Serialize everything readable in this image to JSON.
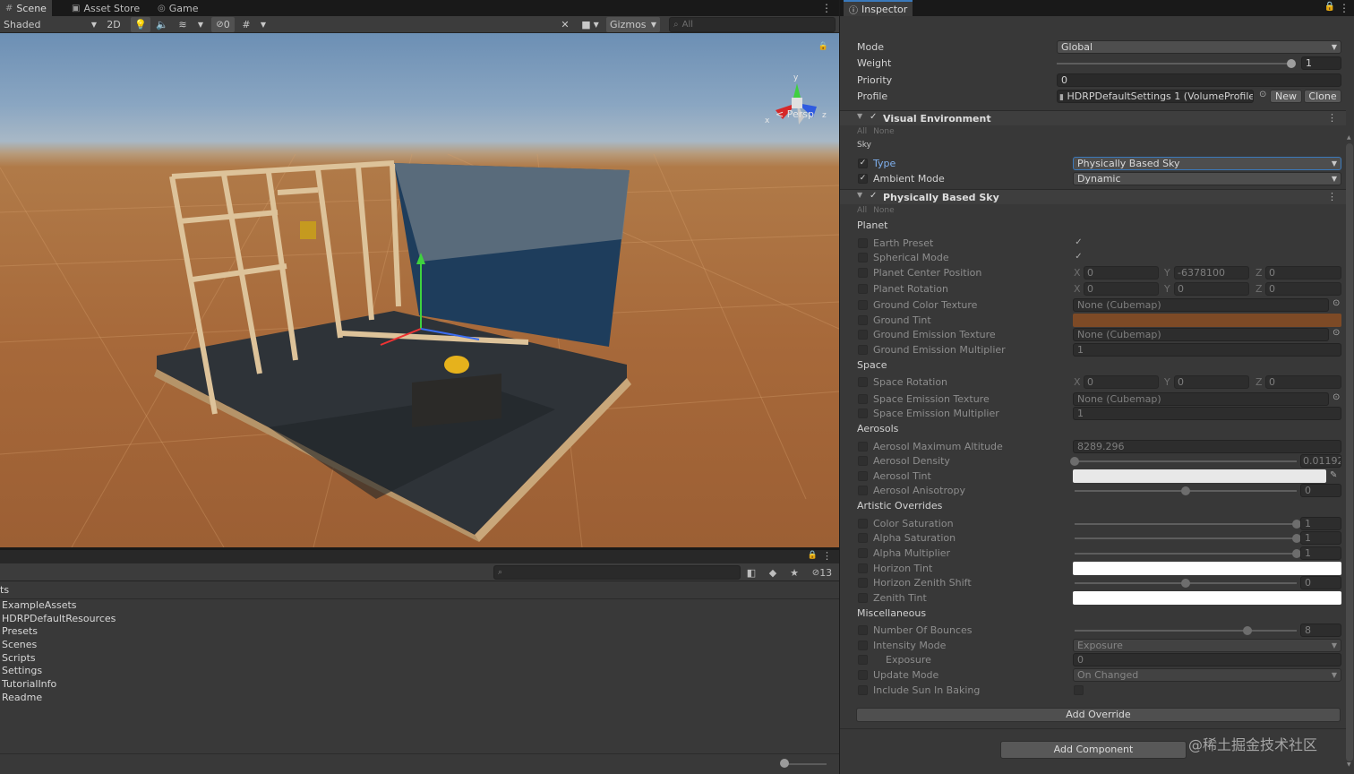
{
  "scene": {
    "tabs": [
      {
        "label": "Scene",
        "icon": "grid-icon"
      },
      {
        "label": "Asset Store",
        "icon": "store-icon"
      },
      {
        "label": "Game",
        "icon": "gamepad-icon"
      }
    ],
    "toolbar": {
      "draw_mode": "Shaded",
      "mode_2d": "2D",
      "hidden_count": "0",
      "gizmos": "Gizmos",
      "search_placeholder": "All"
    },
    "view_label": "Persp",
    "axis_labels": {
      "x": "x",
      "y": "y",
      "z": "z"
    }
  },
  "project": {
    "search_placeholder": "",
    "hidden_count": "13",
    "assets_title": "ts",
    "folders": [
      "ExampleAssets",
      "HDRPDefaultResources",
      "Presets",
      "Scenes",
      "Scripts",
      "Settings",
      "TutorialInfo",
      "Readme"
    ]
  },
  "inspector": {
    "tab_label": "Inspector",
    "volume": {
      "mode_label": "Mode",
      "mode_value": "Global",
      "weight_label": "Weight",
      "weight_value": "1",
      "weight_fraction": 1.0,
      "priority_label": "Priority",
      "priority_value": "0",
      "profile_label": "Profile",
      "profile_value": "HDRPDefaultSettings 1 (VolumeProfile)",
      "new_label": "New",
      "clone_label": "Clone"
    },
    "visual_env": {
      "title": "Visual Environment",
      "all": "All",
      "none": "None",
      "sky_label": "Sky",
      "type_label": "Type",
      "type_value": "Physically Based Sky",
      "ambient_label": "Ambient Mode",
      "ambient_value": "Dynamic"
    },
    "pbs": {
      "title": "Physically Based Sky",
      "all": "All",
      "none": "None",
      "planet": "Planet",
      "earth_preset": "Earth Preset",
      "spherical_mode": "Spherical Mode",
      "planet_center": "Planet Center Position",
      "planet_center_values": {
        "x": "0",
        "y": "-6378100",
        "z": "0"
      },
      "planet_rotation": "Planet Rotation",
      "planet_rotation_values": {
        "x": "0",
        "y": "0",
        "z": "0"
      },
      "ground_color_texture": "Ground Color Texture",
      "ground_color_texture_value": "None (Cubemap)",
      "ground_tint": "Ground Tint",
      "ground_tint_color": "#7d4a26",
      "ground_emission_texture": "Ground Emission Texture",
      "ground_emission_texture_value": "None (Cubemap)",
      "ground_emission_multiplier": "Ground Emission Multiplier",
      "ground_emission_multiplier_value": "1",
      "space": "Space",
      "space_rotation": "Space Rotation",
      "space_rotation_values": {
        "x": "0",
        "y": "0",
        "z": "0"
      },
      "space_emission_texture": "Space Emission Texture",
      "space_emission_texture_value": "None (Cubemap)",
      "space_emission_multiplier": "Space Emission Multiplier",
      "space_emission_multiplier_value": "1",
      "aerosols": "Aerosols",
      "aerosol_max_altitude": "Aerosol Maximum Altitude",
      "aerosol_max_altitude_value": "8289.296",
      "aerosol_density": "Aerosol Density",
      "aerosol_density_value": "0.01192",
      "aerosol_density_fraction": 0.0,
      "aerosol_tint": "Aerosol Tint",
      "aerosol_tint_color": "#e8e8e8",
      "aerosol_anisotropy": "Aerosol Anisotropy",
      "aerosol_anisotropy_value": "0",
      "aerosol_anisotropy_fraction": 0.5,
      "artistic": "Artistic Overrides",
      "color_saturation": "Color Saturation",
      "color_saturation_value": "1",
      "color_saturation_fraction": 1.0,
      "alpha_saturation": "Alpha Saturation",
      "alpha_saturation_value": "1",
      "alpha_saturation_fraction": 1.0,
      "alpha_multiplier": "Alpha Multiplier",
      "alpha_multiplier_value": "1",
      "alpha_multiplier_fraction": 1.0,
      "horizon_tint": "Horizon Tint",
      "horizon_tint_color": "#ffffff",
      "horizon_zenith_shift": "Horizon Zenith Shift",
      "horizon_zenith_shift_value": "0",
      "horizon_zenith_shift_fraction": 0.5,
      "zenith_tint": "Zenith Tint",
      "zenith_tint_color": "#ffffff",
      "misc": "Miscellaneous",
      "number_of_bounces": "Number Of Bounces",
      "number_of_bounces_value": "8",
      "number_of_bounces_fraction": 0.78,
      "intensity_mode": "Intensity Mode",
      "intensity_mode_value": "Exposure",
      "exposure": "Exposure",
      "exposure_value": "0",
      "update_mode": "Update Mode",
      "update_mode_value": "On Changed",
      "include_sun": "Include Sun In Baking"
    },
    "add_override": "Add Override",
    "add_component": "Add Component"
  },
  "watermark": "@稀土掘金技术社区"
}
